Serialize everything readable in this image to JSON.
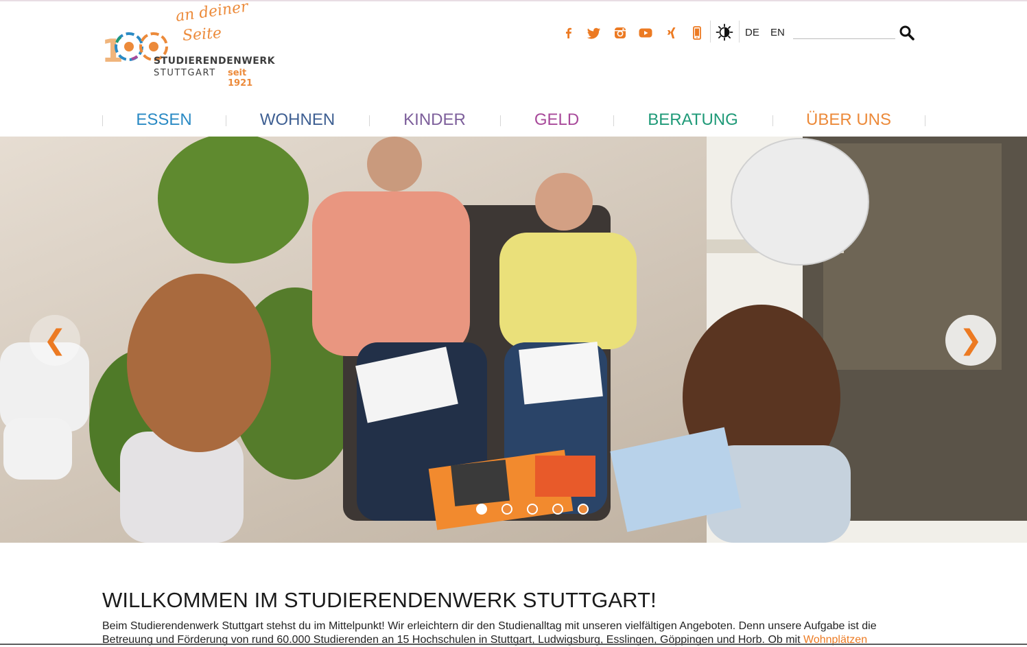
{
  "logo": {
    "slogan_line1": "an deiner",
    "slogan_line2": "Seite",
    "brand": "STUDIERENDENWERK",
    "city": "STUTTGART",
    "since": "seit 1921",
    "anniversary_digit": "1"
  },
  "toolbar": {
    "social_icons": [
      "facebook-icon",
      "twitter-icon",
      "instagram-icon",
      "youtube-icon",
      "xing-icon",
      "mobile-app-icon"
    ],
    "accent_color": "#ec7a22",
    "contrast_icon": "contrast-icon",
    "lang_de": "DE",
    "lang_en": "EN",
    "search_placeholder": "",
    "search_icon": "search-icon"
  },
  "nav": {
    "items": [
      {
        "label": "ESSEN",
        "color": "#2a8ac4"
      },
      {
        "label": "WOHNEN",
        "color": "#3e5f92"
      },
      {
        "label": "KINDER",
        "color": "#7d5f9b"
      },
      {
        "label": "GELD",
        "color": "#a8499a"
      },
      {
        "label": "BERATUNG",
        "color": "#1f9a78"
      },
      {
        "label": "ÜBER UNS",
        "color": "#ec8a3a"
      }
    ]
  },
  "hero": {
    "prev_glyph": "❮",
    "next_glyph": "❯",
    "slide_count": 5,
    "active_slide": 1
  },
  "main": {
    "heading": "WILLKOMMEN IM STUDIERENDENWERK STUTTGART!",
    "intro_line1": "Beim Studierendenwerk Stuttgart stehst du im Mittelpunkt! Wir erleichtern dir den Studienalltag mit unseren vielfältigen Angeboten. Denn unsere Aufgabe ist die",
    "intro_line2": "Betreuung und Förderung von rund 60.000 Studierenden an 15 Hochschulen in Stuttgart, Ludwigsburg, Esslingen, Göppingen und Horb. Ob mit ",
    "intro_link": "Wohnplätzen"
  }
}
